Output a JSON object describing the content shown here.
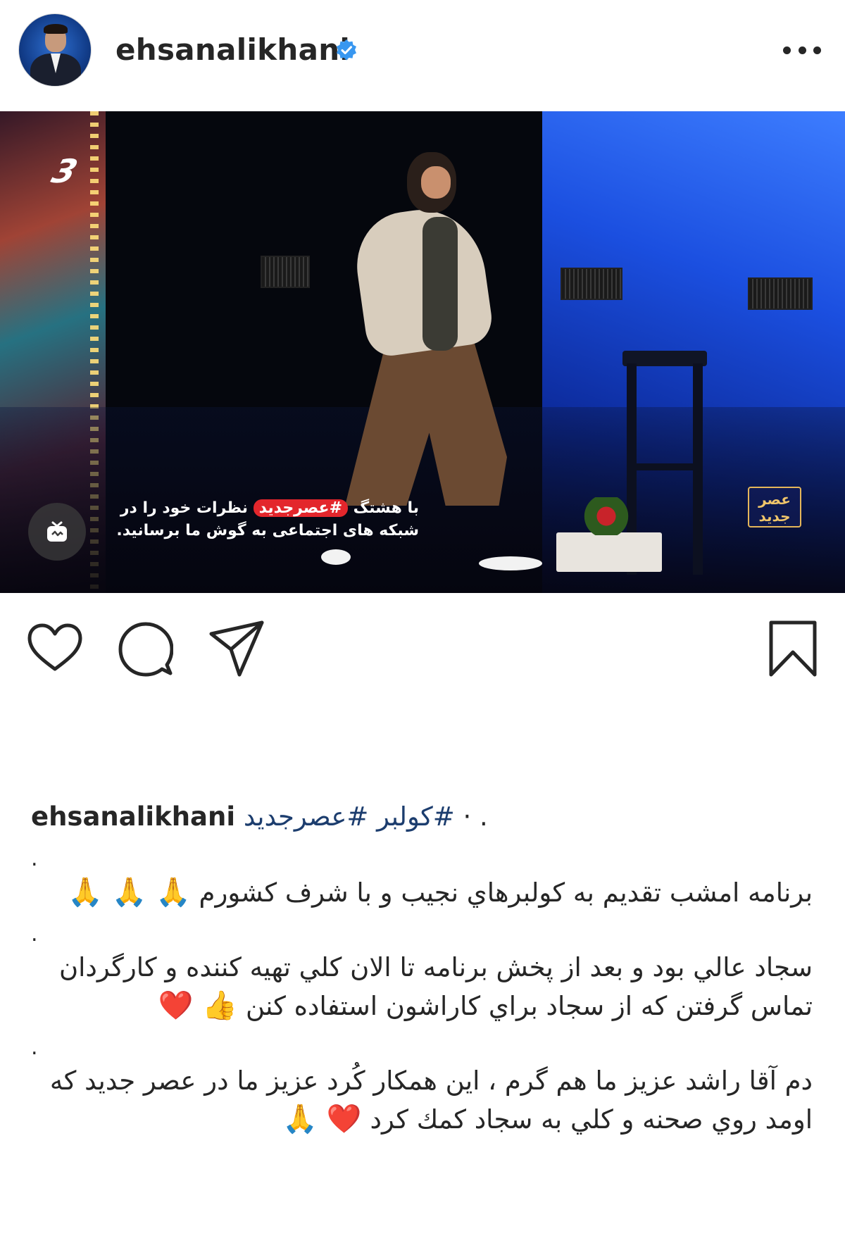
{
  "header": {
    "username": "ehsanalikhani",
    "verified": true
  },
  "media": {
    "overlay_line1_prefix": "با هشتگ",
    "overlay_hashtag": "#عصرجديد",
    "overlay_line1_suffix": "نظرات خود را در",
    "overlay_line2": "شبکه های اجتماعی به گوش ما برسانید.",
    "badge_line1": "عصر",
    "badge_line2": "جديد",
    "channel_logo": "3"
  },
  "icons": {
    "like": "heart-icon",
    "comment": "comment-icon",
    "share": "send-icon",
    "save": "bookmark-icon",
    "igtv": "igtv-icon"
  },
  "caption": {
    "username": "ehsanalikhani",
    "hashtags": "#كولبر #عصرجديد",
    "trailing": "· .",
    "para1": "برنامه امشب تقديم به كولبرهاي نجيب و با شرف كشورم",
    "para1_emoji": "🙏 🙏 🙏",
    "para2": "سجاد عالي بود و بعد از پخش برنامه تا الان كلي تهيه كننده و كارگردان تماس گرفتن كه از سجاد براي كاراشون استفاده كنن",
    "para2_emoji": "👍 ❤️",
    "para3": "دم آقا راشد عزيز ما هم گرم ، اين همكار كُرد عزيز ما در عصر جديد كه اومد روي صحنه و كلي به سجاد كمك كرد",
    "para3_emoji": "❤️ 🙏",
    "separator": "."
  },
  "colors": {
    "verified_blue": "#3897f0",
    "hashtag_blue": "#1c3d6e",
    "tag_red": "#e3262c"
  }
}
